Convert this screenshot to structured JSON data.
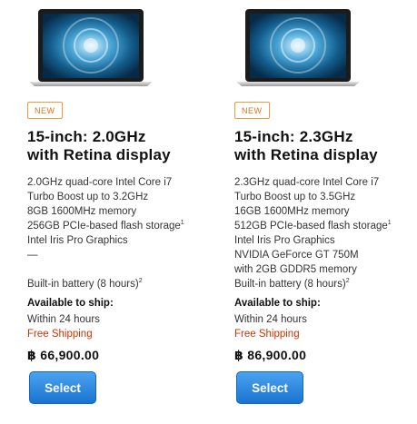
{
  "products": [
    {
      "badge": "NEW",
      "title_line1": "15-inch: 2.0GHz",
      "title_line2": "with Retina display",
      "specs": [
        "2.0GHz quad-core Intel Core i7",
        "Turbo Boost up to 3.2GHz",
        "8GB 1600MHz memory",
        "256GB PCIe-based flash storage",
        "Intel Iris Pro Graphics",
        "—",
        "Built-in battery (8 hours)"
      ],
      "storage_footnote": "1",
      "battery_footnote": "2",
      "ship_label": "Available to ship:",
      "ship_time": "Within 24 hours",
      "shipping": "Free Shipping",
      "price": "฿ 66,900.00",
      "select_label": "Select"
    },
    {
      "badge": "NEW",
      "title_line1": "15-inch: 2.3GHz",
      "title_line2": "with Retina display",
      "specs": [
        "2.3GHz quad-core Intel Core i7",
        "Turbo Boost up to 3.5GHz",
        "16GB 1600MHz memory",
        "512GB PCIe-based flash storage",
        "Intel Iris Pro Graphics",
        "NVIDIA GeForce GT 750M",
        "with 2GB GDDR5 memory",
        "Built-in battery (8 hours)"
      ],
      "storage_footnote": "1",
      "battery_footnote": "2",
      "ship_label": "Available to ship:",
      "ship_time": "Within 24 hours",
      "shipping": "Free Shipping",
      "price": "฿ 86,900.00",
      "select_label": "Select"
    }
  ],
  "colors": {
    "badge": "#d9751f",
    "free_shipping": "#cc3300",
    "button": "#1a73d0"
  },
  "icons": {
    "product_image": "macbook-pro-retina-laptop-icon"
  }
}
